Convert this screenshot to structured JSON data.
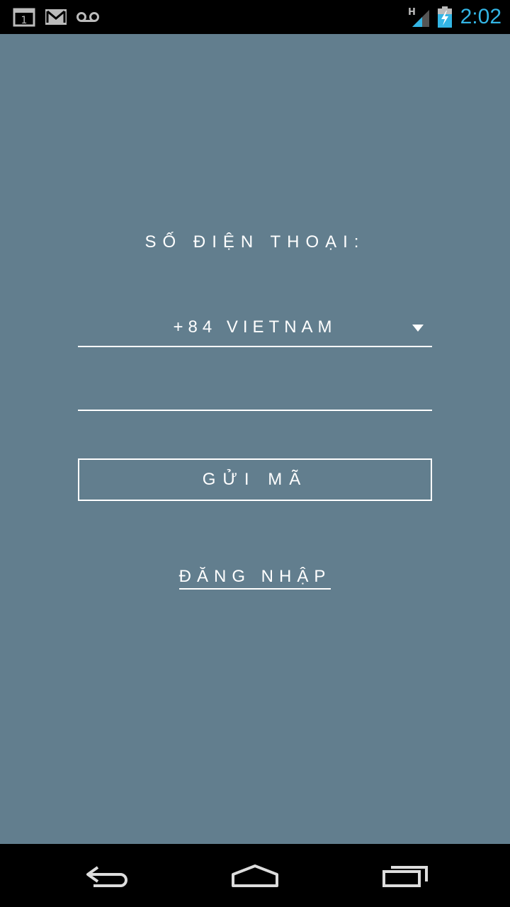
{
  "status_bar": {
    "time": "2:02",
    "calendar_day": "1",
    "network_type": "H",
    "icons": [
      "calendar-icon",
      "gmail-icon",
      "voicemail-icon",
      "signal-icon",
      "battery-charging-icon"
    ]
  },
  "form": {
    "phone_label": "SỐ ĐIỆN THOẠI:",
    "country_value": "+84 VIETNAM",
    "phone_placeholder": "",
    "send_code_label": "GỬI MÃ",
    "login_label": "ĐĂNG NHẬP"
  },
  "nav_bar": {
    "icons": [
      "back-icon",
      "home-icon",
      "recent-apps-icon"
    ]
  },
  "colors": {
    "background": "#627e8e",
    "accent_time": "#33b5e5",
    "text": "#ffffff"
  }
}
